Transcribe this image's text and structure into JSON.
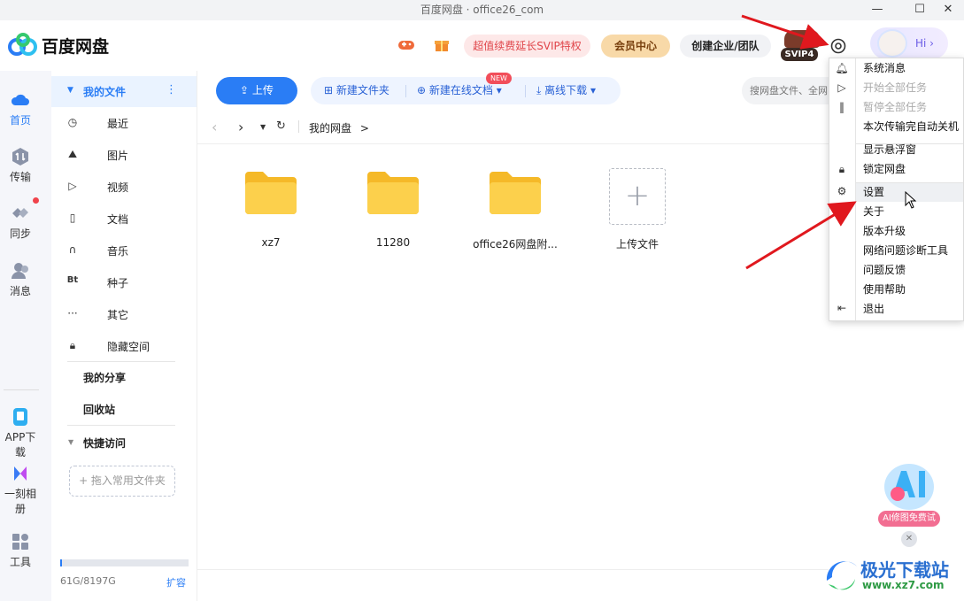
{
  "window": {
    "title": "百度网盘 · office26_com"
  },
  "header": {
    "logo_text": "百度网盘",
    "promo": "超值续费延长SVIP特权",
    "vip_center": "会员中心",
    "enterprise": "创建企业/团队",
    "svip_badge": "SVIP4",
    "hi": "Hi ›"
  },
  "rail": {
    "home": "首页",
    "transfer": "传输",
    "sync": "同步",
    "message": "消息",
    "app": "APP下载",
    "album": "一刻相册",
    "tools": "工具"
  },
  "sidebar": {
    "my_files": "我的文件",
    "items": [
      "最近",
      "图片",
      "视频",
      "文档",
      "音乐",
      "种子",
      "其它",
      "隐藏空间"
    ],
    "seed_icon": "Bt",
    "my_share": "我的分享",
    "recycle": "回收站",
    "quick_access": "快捷访问",
    "drag_hint": "+ 拖入常用文件夹",
    "storage": "61G/8197G",
    "storage_used_fraction": 0.007,
    "expand": "扩容"
  },
  "toolbar": {
    "upload": "上传",
    "new_folder": "新建文件夹",
    "new_doc": "新建在线文档",
    "new_badge": "NEW",
    "offline": "离线下载",
    "search_placeholder": "搜网盘文件、全网"
  },
  "breadcrumb": {
    "path": "我的网盘",
    "sep": ">"
  },
  "files": [
    {
      "name": "xz7"
    },
    {
      "name": "11280"
    },
    {
      "name": "office26网盘附..."
    }
  ],
  "upload_tile": "上传文件",
  "menu": {
    "items": [
      {
        "label": "系统消息",
        "disabled": false
      },
      {
        "label": "开始全部任务",
        "disabled": true
      },
      {
        "label": "暂停全部任务",
        "disabled": true
      },
      {
        "label": "本次传输完自动关机",
        "disabled": false
      },
      {
        "label": "显示悬浮窗",
        "disabled": false
      },
      {
        "label": "锁定网盘",
        "disabled": false
      },
      {
        "label": "设置",
        "disabled": false
      },
      {
        "label": "关于",
        "disabled": false
      },
      {
        "label": "版本升级",
        "disabled": false
      },
      {
        "label": "网络问题诊断工具",
        "disabled": false
      },
      {
        "label": "问题反馈",
        "disabled": false
      },
      {
        "label": "使用帮助",
        "disabled": false
      },
      {
        "label": "退出",
        "disabled": false
      }
    ]
  },
  "ai": {
    "label": "AI修图免费试"
  },
  "watermark": {
    "text": "极光下载站",
    "url": "www.xz7.com"
  },
  "colors": {
    "accent": "#2a7df5",
    "rail_bg": "#f5f6fa",
    "folder": "#f7c537",
    "arrow": "#e0181e"
  }
}
